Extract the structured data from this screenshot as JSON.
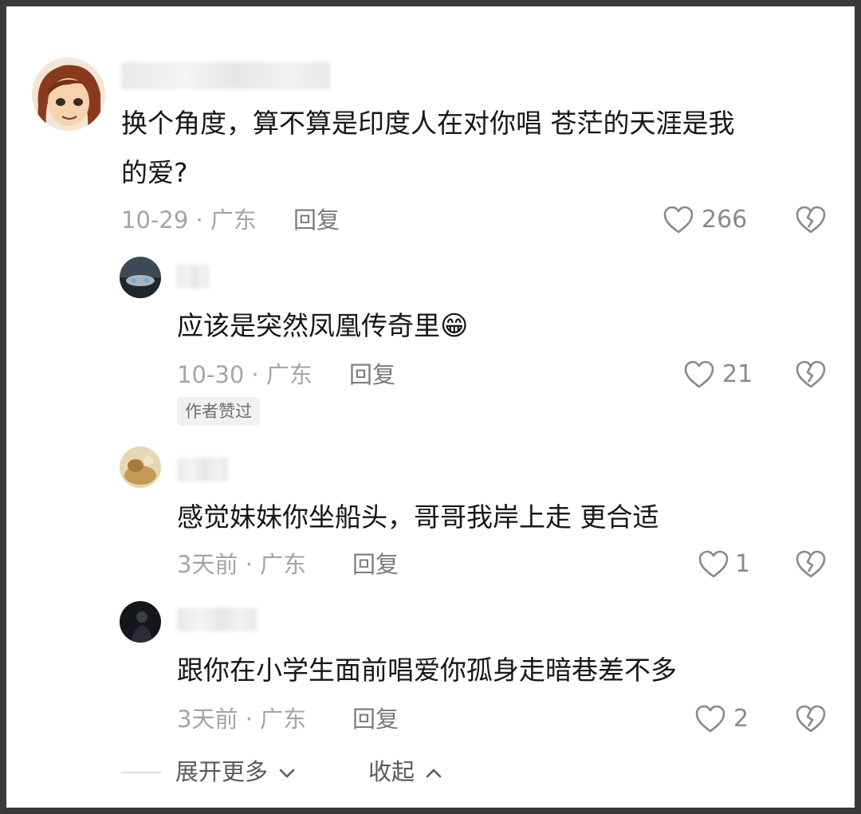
{
  "comments": [
    {
      "text_line1": "换个角度，算不算是印度人在对你唱 苍茫的天涯是我",
      "text_line2": "的爱?",
      "meta": "10-29 · 广东",
      "reply_label": "回复",
      "likes": "266"
    }
  ],
  "replies": [
    {
      "text": "应该是突然凤凰传奇里",
      "emoji": "😁",
      "meta": "10-30 · 广东",
      "reply_label": "回复",
      "likes": "21",
      "badge": "作者赞过"
    },
    {
      "text": "感觉妹妹你坐船头，哥哥我岸上走 更合适",
      "meta": "3天前 · 广东",
      "reply_label": "回复",
      "likes": "1"
    },
    {
      "text": "跟你在小学生面前唱爱你孤身走暗巷差不多",
      "meta": "3天前 · 广东",
      "reply_label": "回复",
      "likes": "2"
    }
  ],
  "footer": {
    "expand_label": "展开更多",
    "collapse_label": "收起"
  },
  "icons": {
    "like": "heart-outline-icon",
    "dislike": "broken-heart-icon",
    "expand": "chevron-down-icon",
    "collapse": "chevron-up-icon"
  },
  "colors": {
    "primary_text": "#161616",
    "meta_text": "#a5a5a5",
    "icon": "#8a8a8a"
  }
}
